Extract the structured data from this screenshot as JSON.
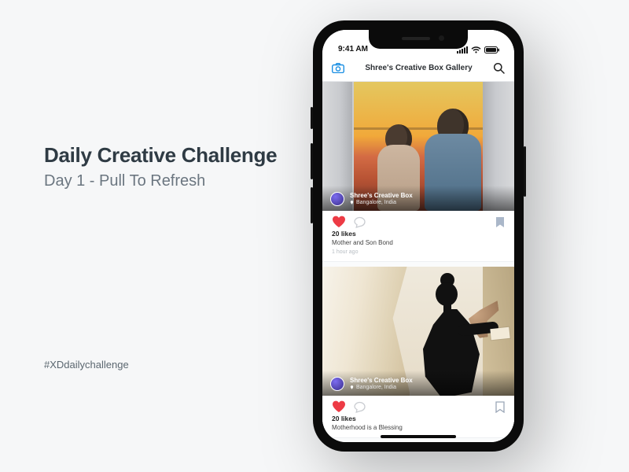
{
  "page": {
    "headline": "Daily Creative Challenge",
    "subline": "Day 1 - Pull To Refresh",
    "hashtag": "#XDdailychallenge"
  },
  "status": {
    "time": "9:41 AM"
  },
  "app": {
    "title": "Shree's Creative Box Gallery"
  },
  "posts": [
    {
      "author": "Shree's Creative Box",
      "location": "Bangalore, India",
      "likes": "20 likes",
      "caption": "Mother and Son Bond",
      "time_ago": "1 hour ago"
    },
    {
      "author": "Shree's Creative Box",
      "location": "Bangalore, India",
      "likes": "20 likes",
      "caption": "Motherhood is a Blessing",
      "time_ago": ""
    }
  ]
}
